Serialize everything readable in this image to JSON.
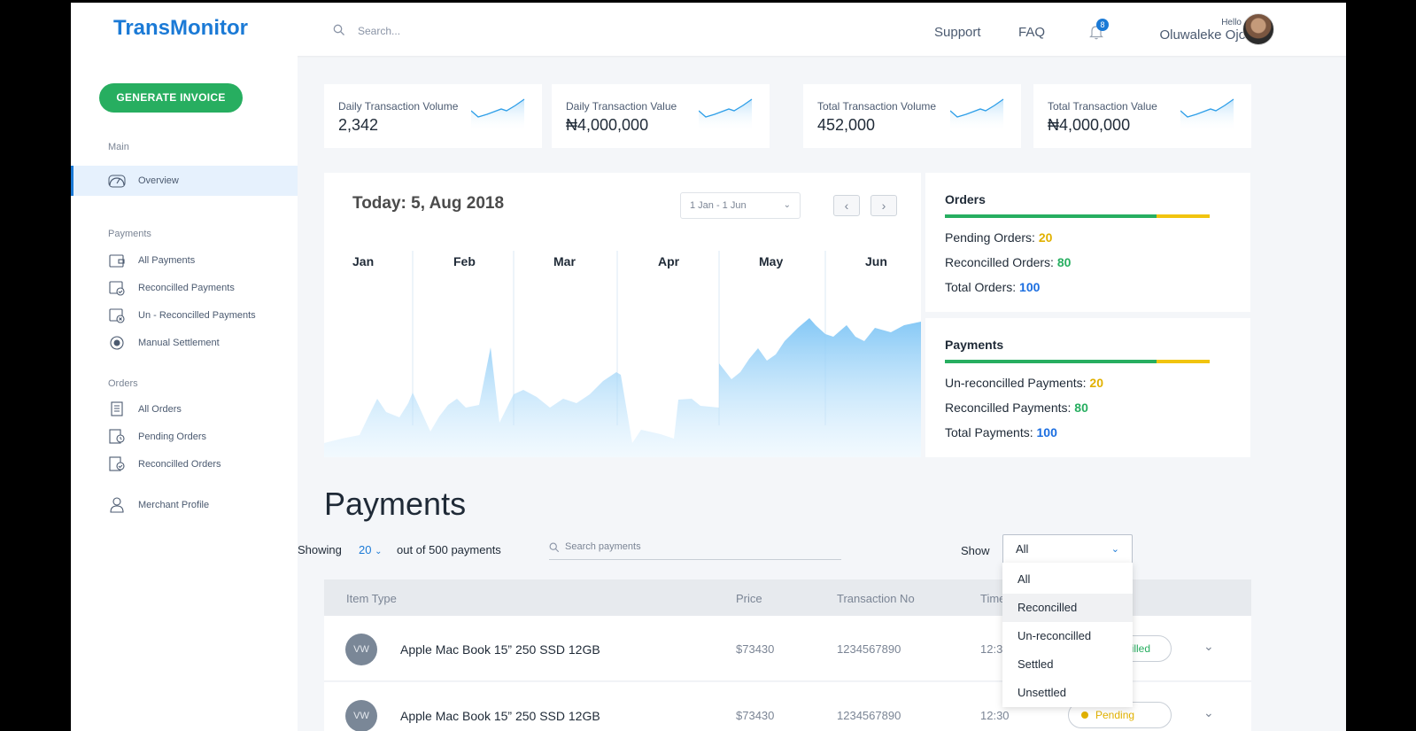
{
  "header": {
    "logo": "TransMonitor",
    "search_placeholder": "Search...",
    "nav": [
      "Support",
      "FAQ"
    ],
    "notification_count": "8",
    "greeting": "Hello",
    "user_name": "Oluwaleke Ojo"
  },
  "sidebar": {
    "generate_button": "GENERATE INVOICE",
    "main_label": "Main",
    "overview": "Overview",
    "payments_label": "Payments",
    "payments_items": [
      "All Payments",
      "Reconcilled Payments",
      "Un - Reconcilled Payments",
      "Manual Settlement"
    ],
    "orders_label": "Orders",
    "orders_items": [
      "All Orders",
      "Pending Orders",
      "Reconcilled Orders"
    ],
    "merchant_profile": "Merchant Profile"
  },
  "stats": [
    {
      "title": "Daily Transaction Volume",
      "value": "2,342"
    },
    {
      "title": "Daily Transaction Value",
      "value": "₦4,000,000"
    },
    {
      "title": "Total Transaction Volume",
      "value": "452,000"
    },
    {
      "title": "Total Transaction Value",
      "value": "₦4,000,000"
    }
  ],
  "chart": {
    "today": "Today: 5, Aug 2018",
    "range": "1 Jan - 1 Jun",
    "prev": "‹",
    "next": "›",
    "months": [
      "Jan",
      "Feb",
      "Mar",
      "Apr",
      "May",
      "Jun"
    ]
  },
  "orders": {
    "title": "Orders",
    "reconciled_fraction": 0.8,
    "pending_label": "Pending Orders:",
    "pending_value": "20",
    "reconciled_label": "Reconcilled Orders:",
    "reconciled_value": "80",
    "total_label": "Total Orders:",
    "total_value": "100"
  },
  "payments_panel": {
    "title": "Payments",
    "reconciled_fraction": 0.8,
    "unreconciled_label": "Un-reconcilled Payments:",
    "unreconciled_value": "20",
    "reconciled_label": "Reconcilled Payments:",
    "reconciled_value": "80",
    "total_label": "Total Payments:",
    "total_value": "100"
  },
  "payments": {
    "title": "Payments",
    "showing": "Showing",
    "page_size": "20",
    "out_of": "out of 500 payments",
    "search_placeholder": "Search payments",
    "show_label": "Show",
    "filter_value": "All",
    "filter_options": [
      "All",
      "Reconcilled",
      "Un-reconcilled",
      "Settled",
      "Unsettled"
    ],
    "highlighted_option": "Reconcilled",
    "columns": [
      "Item Type",
      "Price",
      "Transaction No",
      "Time"
    ],
    "rows": [
      {
        "initials": "VW",
        "item": "Apple Mac Book 15” 250 SSD 12GB",
        "price": "$73430",
        "txn": "1234567890",
        "time": "12:30",
        "status": "Reconcilled"
      },
      {
        "initials": "VW",
        "item": "Apple Mac Book 15” 250 SSD 12GB",
        "price": "$73430",
        "txn": "1234567890",
        "time": "12:30",
        "status": "Pending"
      }
    ]
  }
}
